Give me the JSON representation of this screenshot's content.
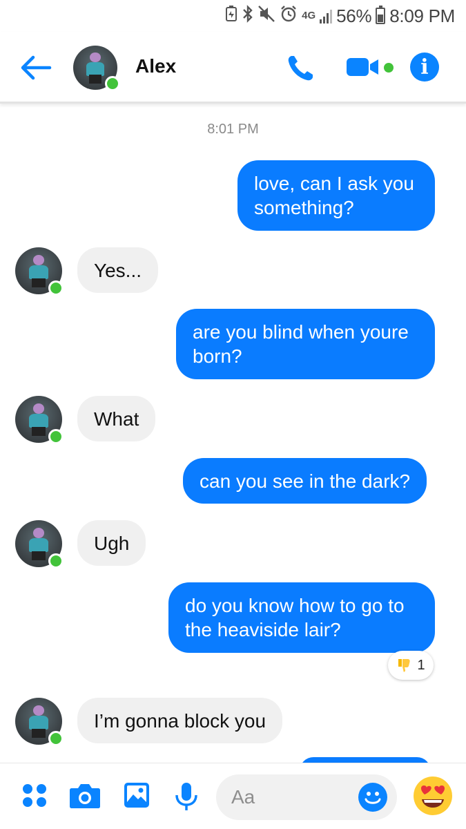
{
  "status_bar": {
    "network": "4G",
    "battery": "56%",
    "time": "8:09 PM"
  },
  "header": {
    "contact_name": "Alex",
    "accent_color": "#0a84ff",
    "online_color": "#42c33a"
  },
  "conversation": {
    "timestamp": "8:01 PM",
    "messages": [
      {
        "from": "me",
        "text": "love, can I ask you something?"
      },
      {
        "from": "Alex",
        "text": "Yes..."
      },
      {
        "from": "me",
        "text": "are you blind when youre born?"
      },
      {
        "from": "Alex",
        "text": "What"
      },
      {
        "from": "me",
        "text": "can you see in the dark?"
      },
      {
        "from": "Alex",
        "text": "Ugh"
      },
      {
        "from": "me",
        "text": "do you know how to go to the heaviside lair?",
        "reaction": {
          "icon": "thumbs-down-icon",
          "count": "1"
        }
      },
      {
        "from": "Alex",
        "text": "I’m gonna block you"
      }
    ]
  },
  "composer": {
    "placeholder": "Aa",
    "icons": [
      "more-apps-icon",
      "camera-icon",
      "gallery-icon",
      "microphone-icon",
      "emoji-icon",
      "heart-eyes-emoji-icon"
    ]
  }
}
